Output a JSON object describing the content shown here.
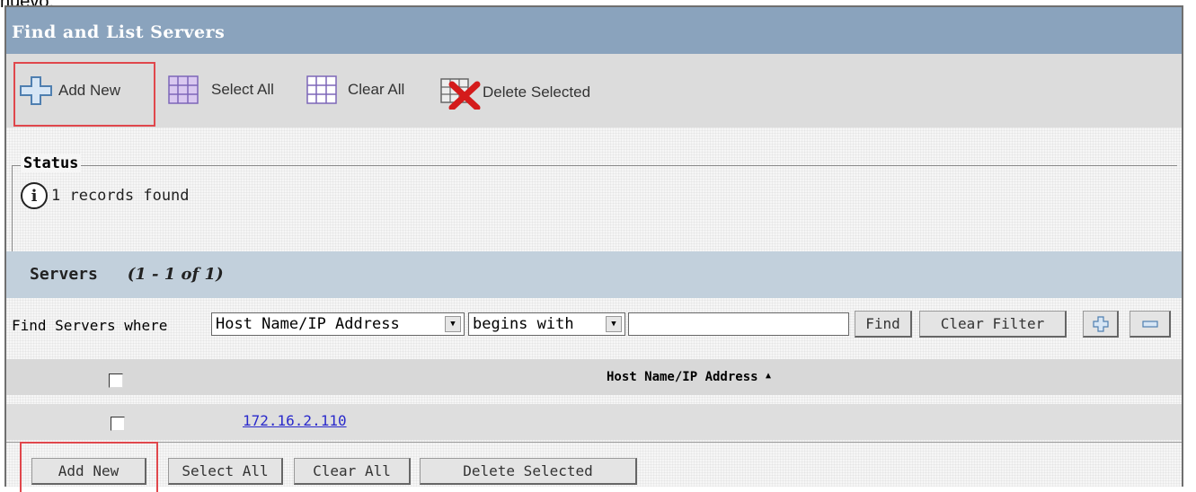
{
  "overflow_text": "nuevo.",
  "title": "Find and List Servers",
  "toolbar": {
    "add_new": "Add New",
    "select_all": "Select All",
    "clear_all": "Clear All",
    "delete_selected": "Delete Selected"
  },
  "status": {
    "legend": "Status",
    "message": "1 records found"
  },
  "servers": {
    "title": "Servers",
    "count": "(1 - 1 of 1)"
  },
  "filter": {
    "label": "Find Servers where",
    "field": "Host Name/IP Address",
    "operator": "begins with",
    "value": "",
    "find": "Find",
    "clear_filter": "Clear Filter"
  },
  "table": {
    "column": "Host Name/IP Address",
    "rows": [
      {
        "host": "172.16.2.110"
      }
    ]
  },
  "bottom": {
    "add_new": "Add New",
    "select_all": "Select All",
    "clear_all": "Clear All",
    "delete_selected": "Delete Selected"
  },
  "colors": {
    "title_bar": "#8aa3bd",
    "section_bar": "#c2d0dc",
    "highlight": "#e0474c",
    "link": "#2a2acb"
  }
}
